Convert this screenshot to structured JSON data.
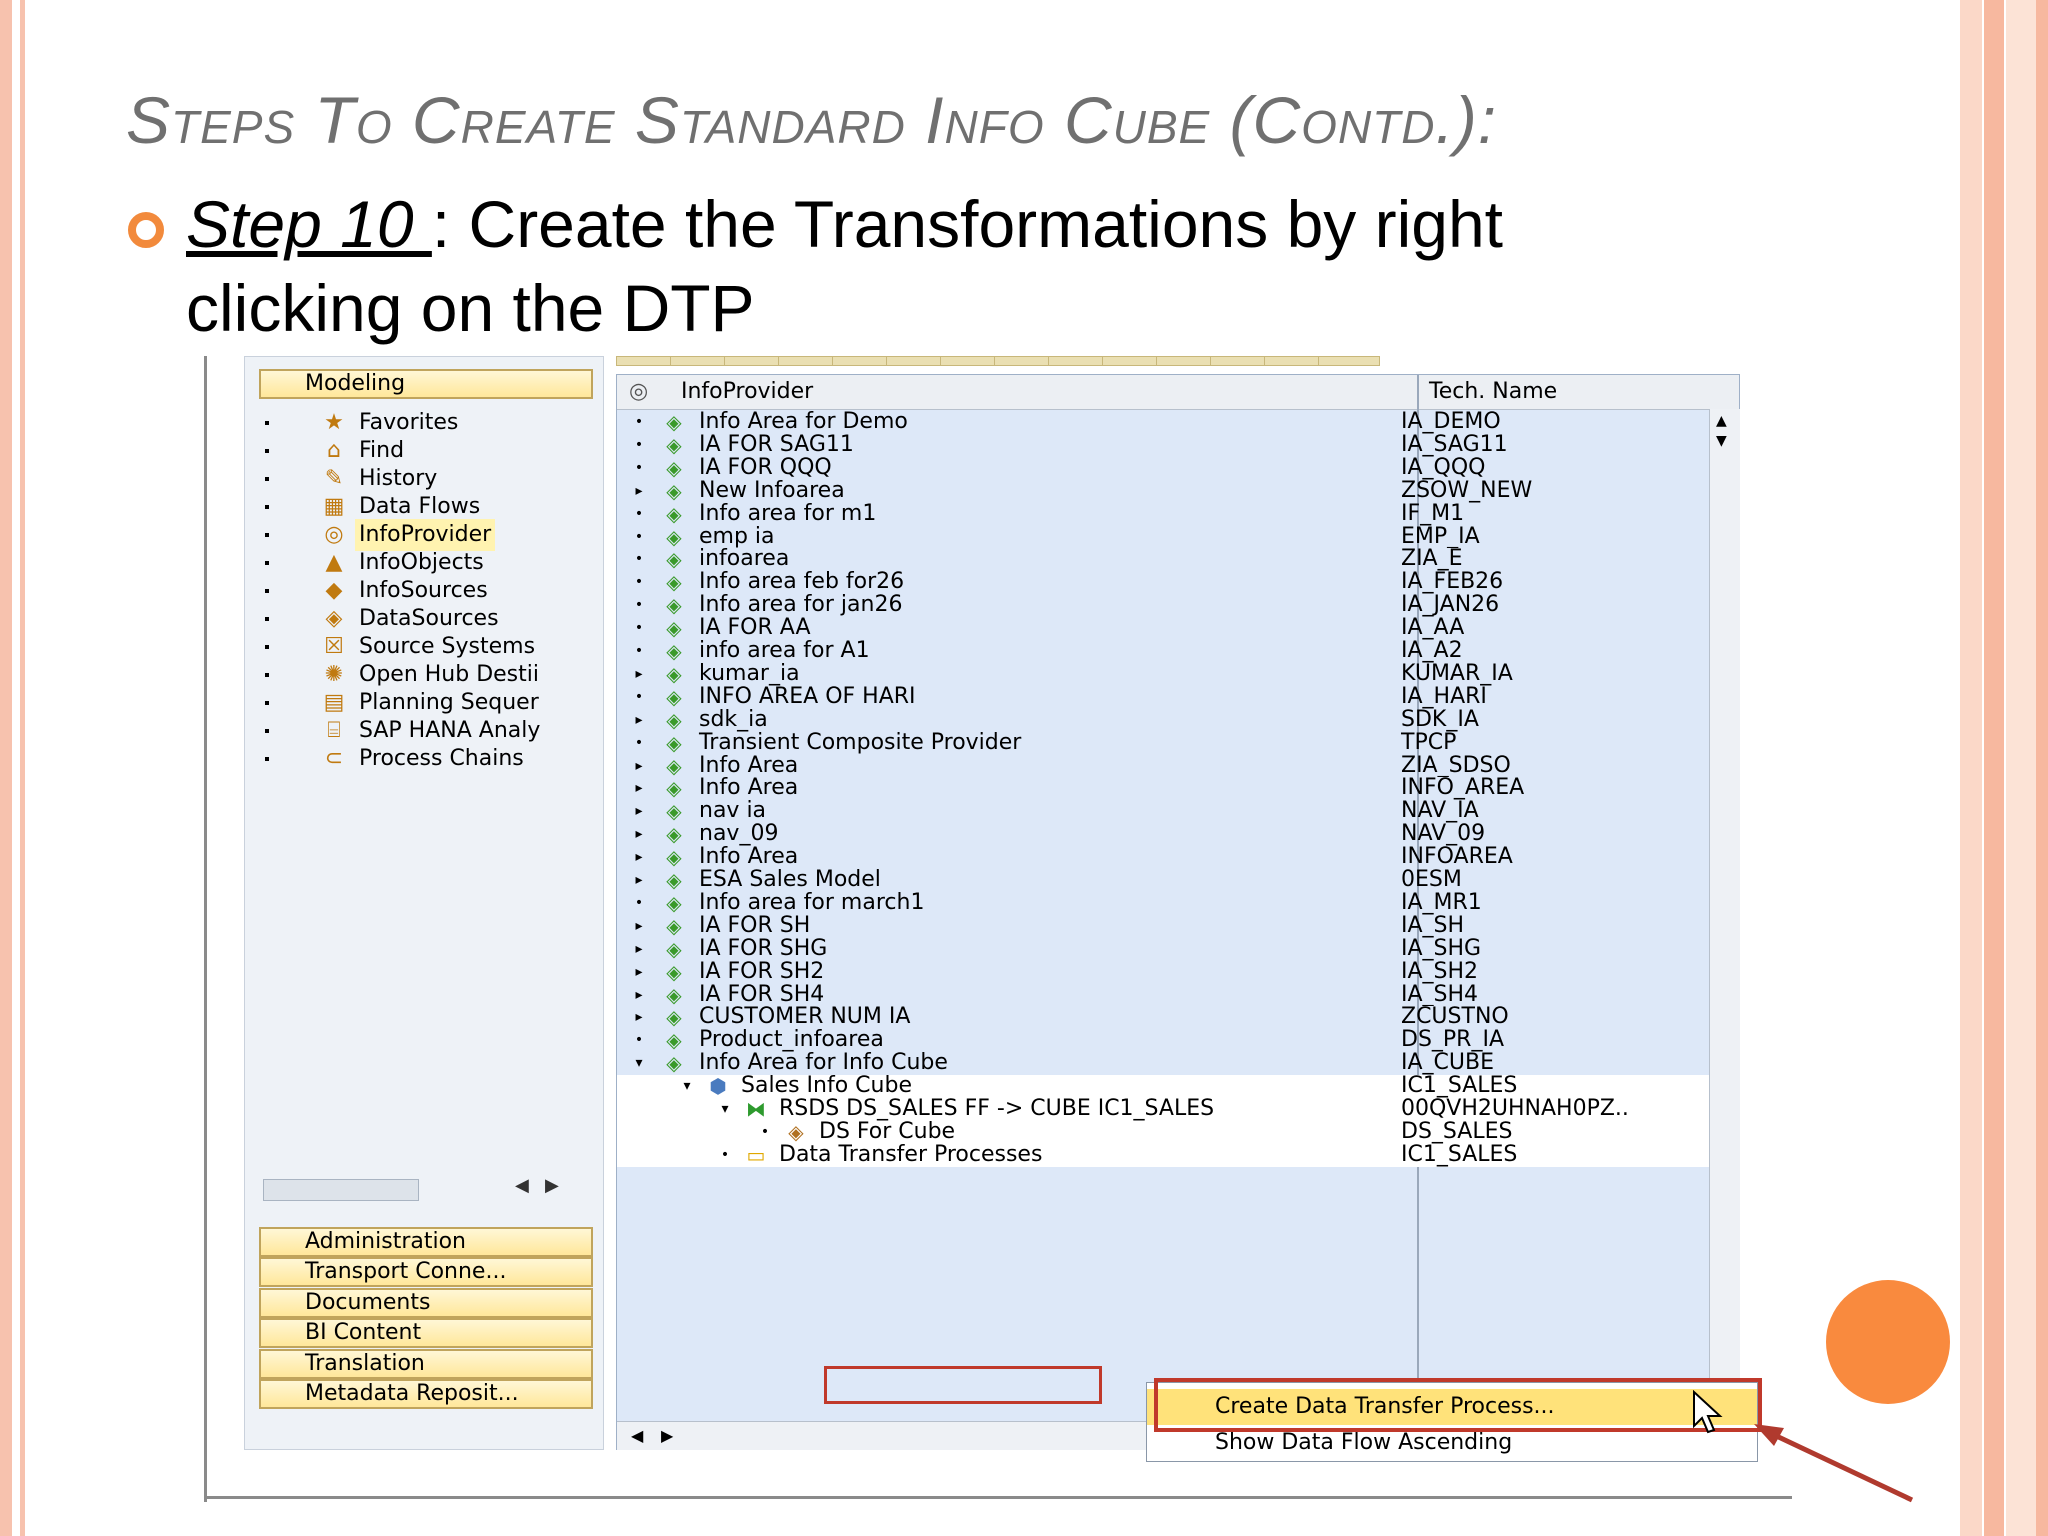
{
  "slide": {
    "title": "Steps To Create Standard Info Cube (Contd.):",
    "step_label": "Step 10 ",
    "step_text": ": Create the Transformations by right",
    "step_text_line2": "clicking on the DTP"
  },
  "colors": {
    "accent": "#f28a3c",
    "title": "#707070",
    "highlight_box": "#c0392b",
    "menu_highlight": "#ffe27a"
  },
  "left_pane": {
    "modeling_button": "Modeling",
    "items": [
      {
        "label": "Favorites",
        "icon": "star-icon"
      },
      {
        "label": "Find",
        "icon": "binoculars-icon"
      },
      {
        "label": "History",
        "icon": "history-icon"
      },
      {
        "label": "Data Flows",
        "icon": "data-flows-icon"
      },
      {
        "label": "InfoProvider",
        "icon": "infoprovider-icon"
      },
      {
        "label": "InfoObjects",
        "icon": "infoobjects-icon"
      },
      {
        "label": "InfoSources",
        "icon": "infosources-icon"
      },
      {
        "label": "DataSources",
        "icon": "datasources-icon"
      },
      {
        "label": "Source Systems",
        "icon": "source-systems-icon"
      },
      {
        "label": "Open Hub Destii",
        "icon": "open-hub-icon"
      },
      {
        "label": "Planning Sequer",
        "icon": "planning-icon"
      },
      {
        "label": "SAP HANA Analy",
        "icon": "hana-icon"
      },
      {
        "label": "Process Chains",
        "icon": "process-chains-icon"
      }
    ],
    "selected_index": 4,
    "bottom_buttons": [
      "Administration",
      "Transport Conne...",
      "Documents",
      "BI Content",
      "Translation",
      "Metadata Reposit..."
    ]
  },
  "tree": {
    "col_infoprovider": "InfoProvider",
    "col_tech_name": "Tech. Name",
    "rows": [
      {
        "name": "Info Area for Demo",
        "tech": "IA_DEMO",
        "exp": "•"
      },
      {
        "name": "IA FOR SAG11",
        "tech": "IA_SAG11",
        "exp": "•"
      },
      {
        "name": "IA FOR QQQ",
        "tech": "IA_QQQ",
        "exp": "•"
      },
      {
        "name": "New Infoarea",
        "tech": "ZSOW_NEW",
        "exp": "▸"
      },
      {
        "name": "Info area for m1",
        "tech": "IF_M1",
        "exp": "•"
      },
      {
        "name": "emp ia",
        "tech": "EMP_IA",
        "exp": "•"
      },
      {
        "name": "infoarea",
        "tech": "ZIA_E",
        "exp": "•"
      },
      {
        "name": "Info area feb for26",
        "tech": "IA_FEB26",
        "exp": "•"
      },
      {
        "name": "Info area for jan26",
        "tech": "IA_JAN26",
        "exp": "•"
      },
      {
        "name": "IA FOR AA",
        "tech": "IA_AA",
        "exp": "•"
      },
      {
        "name": "info area for A1",
        "tech": "IA_A2",
        "exp": "•"
      },
      {
        "name": "kumar_ia",
        "tech": "KUMAR_IA",
        "exp": "▸"
      },
      {
        "name": "INFO AREA OF HARI",
        "tech": "IA_HARI",
        "exp": "•"
      },
      {
        "name": "sdk_ia",
        "tech": "SDK_IA",
        "exp": "▸"
      },
      {
        "name": "Transient Composite Provider",
        "tech": "TPCP",
        "exp": "•"
      },
      {
        "name": "Info Area",
        "tech": "ZIA_SDSO",
        "exp": "▸"
      },
      {
        "name": "Info Area",
        "tech": "INFO_AREA",
        "exp": "▸"
      },
      {
        "name": "nav ia",
        "tech": "NAV_IA",
        "exp": "▸"
      },
      {
        "name": "nav_09",
        "tech": "NAV_09",
        "exp": "▸"
      },
      {
        "name": "Info Area",
        "tech": "INFOAREA",
        "exp": "▸"
      },
      {
        "name": "ESA Sales Model",
        "tech": "0ESM",
        "exp": "▸"
      },
      {
        "name": "Info area for march1",
        "tech": "IA_MR1",
        "exp": "•"
      },
      {
        "name": "IA FOR SH",
        "tech": "IA_SH",
        "exp": "▸"
      },
      {
        "name": "IA FOR SHG",
        "tech": "IA_SHG",
        "exp": "▸"
      },
      {
        "name": "IA FOR SH2",
        "tech": "IA_SH2",
        "exp": "▸"
      },
      {
        "name": "IA FOR SH4",
        "tech": "IA_SH4",
        "exp": "▸"
      },
      {
        "name": "CUSTOMER NUM IA",
        "tech": "ZCUSTNO",
        "exp": "▸"
      },
      {
        "name": "Product_infoarea",
        "tech": "DS_PR_IA",
        "exp": "•"
      },
      {
        "name": "Info Area for Info Cube",
        "tech": "IA_CUBE",
        "exp": "▾"
      }
    ],
    "sub_rows": [
      {
        "name": "Sales Info Cube",
        "tech": "IC1_SALES",
        "exp": "▾",
        "icon": "cube-icon"
      },
      {
        "name": "RSDS DS_SALES FF -> CUBE IC1_SALES",
        "tech": "00QVH2UHNAH0PZ..",
        "exp": "▾",
        "icon": "transformation-icon"
      },
      {
        "name": "DS For Cube",
        "tech": "DS_SALES",
        "exp": "•",
        "icon": "datasource-icon"
      },
      {
        "name": "Data Transfer Processes",
        "tech": "IC1_SALES",
        "exp": "•",
        "icon": "folder-icon"
      }
    ]
  },
  "context_menu": {
    "items": [
      "Create Data Transfer Process...",
      "Show Data Flow Ascending"
    ]
  }
}
